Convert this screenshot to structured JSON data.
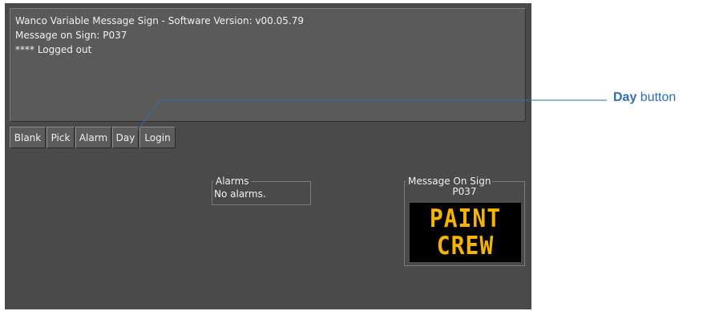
{
  "log": {
    "lines": [
      "Wanco Variable Message Sign - Software Version: v00.05.79",
      "Message on Sign: P037",
      "**** Logged out"
    ]
  },
  "buttons": [
    "Blank",
    "Pick",
    "Alarm",
    "Day",
    "Login"
  ],
  "alarms": {
    "title": "Alarms",
    "text": "No alarms."
  },
  "message_on_sign": {
    "title": "Message On Sign",
    "code": "P037",
    "lines": [
      "PAINT",
      "CREW"
    ],
    "colors": {
      "text": "#f5b400",
      "background": "#000000"
    }
  },
  "callout": {
    "bold": "Day",
    "rest": " button"
  }
}
